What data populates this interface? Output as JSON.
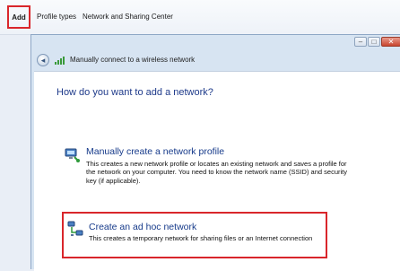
{
  "toolbar": {
    "add_label": "Add",
    "profile_types_label": "Profile types",
    "network_sharing_label": "Network and Sharing Center"
  },
  "wizard": {
    "title": "Manually connect to a wireless network",
    "question": "How do you want to add a network?",
    "options": [
      {
        "title": "Manually create a network profile",
        "description": "This creates a new network profile or locates an existing network and saves a profile for the network on your computer. You need to know the network name (SSID) and security key (if applicable).",
        "icon": "network-profile-icon"
      },
      {
        "title": "Create an ad hoc network",
        "description": "This creates a temporary network for sharing files or an Internet connection",
        "icon": "adhoc-network-icon"
      }
    ]
  },
  "icons": {
    "back": "back-arrow-icon",
    "signal": "wireless-signal-icon"
  },
  "colors": {
    "highlight": "#d9262b",
    "link_blue": "#163a8a",
    "heading_blue": "#1e3a8a",
    "frame": "#d7e4f2"
  }
}
